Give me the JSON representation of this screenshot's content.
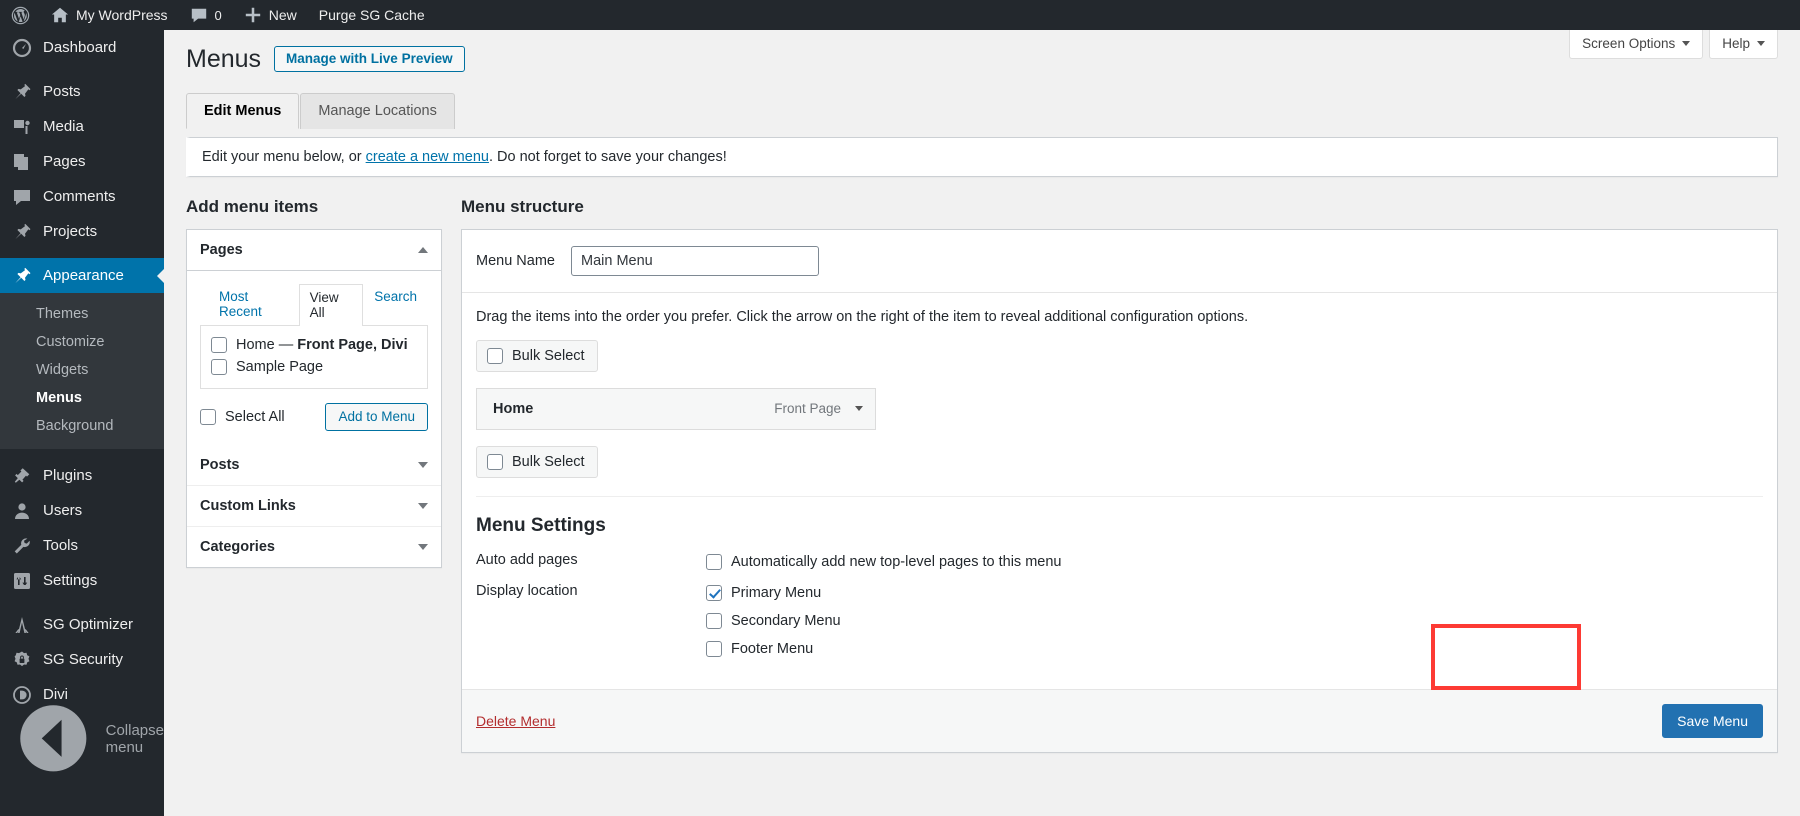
{
  "adminbar": {
    "site_name": "My WordPress",
    "comments_count": "0",
    "new_label": "New",
    "purge_label": "Purge SG Cache",
    "logo_icon": "wordpress-logo-icon",
    "home_icon": "home-icon",
    "comment_icon": "comment-bubble-icon",
    "plus_icon": "plus-icon"
  },
  "sidebar": {
    "items": [
      {
        "label": "Dashboard",
        "icon": "dashboard-icon"
      },
      {
        "label": "Posts",
        "icon": "pin-icon"
      },
      {
        "label": "Media",
        "icon": "media-icon"
      },
      {
        "label": "Pages",
        "icon": "pages-icon"
      },
      {
        "label": "Comments",
        "icon": "comment-bubble-icon"
      },
      {
        "label": "Projects",
        "icon": "pin-icon"
      },
      {
        "label": "Appearance",
        "icon": "paintbrush-icon"
      },
      {
        "label": "Plugins",
        "icon": "plug-icon"
      },
      {
        "label": "Users",
        "icon": "user-icon"
      },
      {
        "label": "Tools",
        "icon": "wrench-icon"
      },
      {
        "label": "Settings",
        "icon": "settings-sliders-icon"
      },
      {
        "label": "SG Optimizer",
        "icon": "sg-optimizer-icon"
      },
      {
        "label": "SG Security",
        "icon": "shield-gear-icon"
      },
      {
        "label": "Divi",
        "icon": "divi-icon"
      }
    ],
    "appearance_submenu": [
      "Themes",
      "Customize",
      "Widgets",
      "Menus",
      "Background"
    ],
    "active_item": "Appearance",
    "current_subitem": "Menus",
    "collapse_label": "Collapse menu",
    "collapse_icon": "collapse-arrow-icon"
  },
  "screen_meta": {
    "screen_options": "Screen Options",
    "help": "Help"
  },
  "header": {
    "title": "Menus",
    "live_preview_button": "Manage with Live Preview"
  },
  "tabs": [
    {
      "label": "Edit Menus",
      "active": true
    },
    {
      "label": "Manage Locations",
      "active": false
    }
  ],
  "notice": {
    "before": "Edit your menu below, or ",
    "link": "create a new menu",
    "after": ". Do not forget to save your changes!"
  },
  "add_menu_items": {
    "heading": "Add menu items",
    "accordions": [
      {
        "title": "Pages",
        "expanded": true
      },
      {
        "title": "Posts",
        "expanded": false
      },
      {
        "title": "Custom Links",
        "expanded": false
      },
      {
        "title": "Categories",
        "expanded": false
      }
    ],
    "pages_panel": {
      "subtabs": [
        {
          "label": "Most Recent",
          "active": false
        },
        {
          "label": "View All",
          "active": true
        },
        {
          "label": "Search",
          "active": false
        }
      ],
      "items": [
        {
          "label": "Home",
          "suffix": " — ",
          "meta": "Front Page, Divi",
          "checked": false
        },
        {
          "label": "Sample Page",
          "suffix": "",
          "meta": "",
          "checked": false
        }
      ],
      "select_all": "Select All",
      "select_all_checked": false,
      "add_button": "Add to Menu"
    }
  },
  "menu_structure": {
    "heading": "Menu structure",
    "menu_name_label": "Menu Name",
    "menu_name_value": "Main Menu",
    "menu_name_placeholder": "Enter menu name here",
    "hint": "Drag the items into the order you prefer. Click the arrow on the right of the item to reveal additional configuration options.",
    "bulk_select_label": "Bulk Select",
    "bulk_select_checked": false,
    "items": [
      {
        "title": "Home",
        "type": "Front Page",
        "expand_icon": "chevron-down-icon"
      }
    ],
    "bulk_select_bottom_label": "Bulk Select",
    "settings": {
      "heading": "Menu Settings",
      "auto_add_label": "Auto add pages",
      "auto_add_option": "Automatically add new top-level pages to this menu",
      "auto_add_checked": false,
      "display_location_label": "Display location",
      "locations": [
        {
          "label": "Primary Menu",
          "checked": true
        },
        {
          "label": "Secondary Menu",
          "checked": false
        },
        {
          "label": "Footer Menu",
          "checked": false
        }
      ]
    },
    "delete_link": "Delete Menu",
    "save_button": "Save Menu"
  },
  "colors": {
    "admin_bar": "#23282d",
    "accent_blue": "#0073aa",
    "primary_button": "#2271b1",
    "highlight_red": "#fd3a34",
    "delete_red": "#b32d2e"
  }
}
